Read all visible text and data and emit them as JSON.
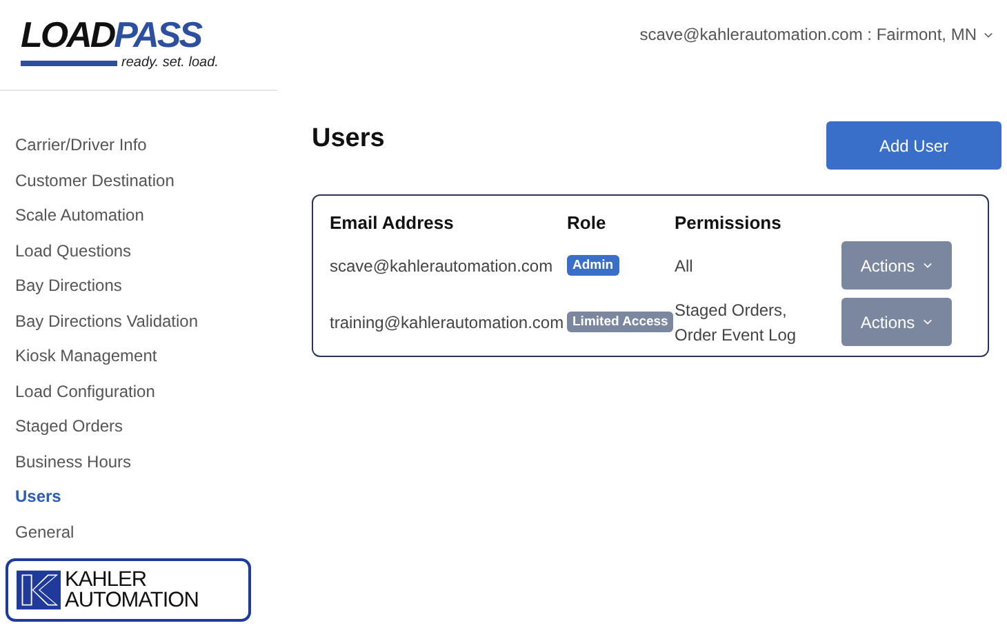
{
  "header": {
    "logo": {
      "word_dark": "LOAD",
      "word_blue": "PASS",
      "tagline": "ready. set. load."
    },
    "account": "scave@kahlerautomation.com : Fairmont, MN"
  },
  "sidebar": {
    "items": [
      {
        "label": "Carrier/Driver Info",
        "selected": false
      },
      {
        "label": "Customer Destination",
        "selected": false
      },
      {
        "label": "Scale Automation",
        "selected": false
      },
      {
        "label": "Load Questions",
        "selected": false
      },
      {
        "label": "Bay Directions",
        "selected": false
      },
      {
        "label": "Bay Directions Validation",
        "selected": false
      },
      {
        "label": "Kiosk Management",
        "selected": false
      },
      {
        "label": "Load Configuration",
        "selected": false
      },
      {
        "label": "Staged Orders",
        "selected": false
      },
      {
        "label": "Business Hours",
        "selected": false
      },
      {
        "label": "Users",
        "selected": true
      },
      {
        "label": "General",
        "selected": false
      }
    ],
    "footer_logo": {
      "line1": "KAHLER",
      "line2": "AUTOMATION"
    }
  },
  "page": {
    "title": "Users",
    "add_button": "Add User"
  },
  "table": {
    "columns": [
      "Email Address",
      "Role",
      "Permissions"
    ],
    "rows": [
      {
        "email": "scave@kahlerautomation.com",
        "role": {
          "label": "Admin",
          "kind": "admin"
        },
        "permissions": [
          "All"
        ],
        "action": "Actions"
      },
      {
        "email": "training@kahlerautomation.com",
        "role": {
          "label": "Limited Access",
          "kind": "limited"
        },
        "permissions": [
          "Staged Orders,",
          "Order Event Log"
        ],
        "action": "Actions"
      }
    ]
  }
}
